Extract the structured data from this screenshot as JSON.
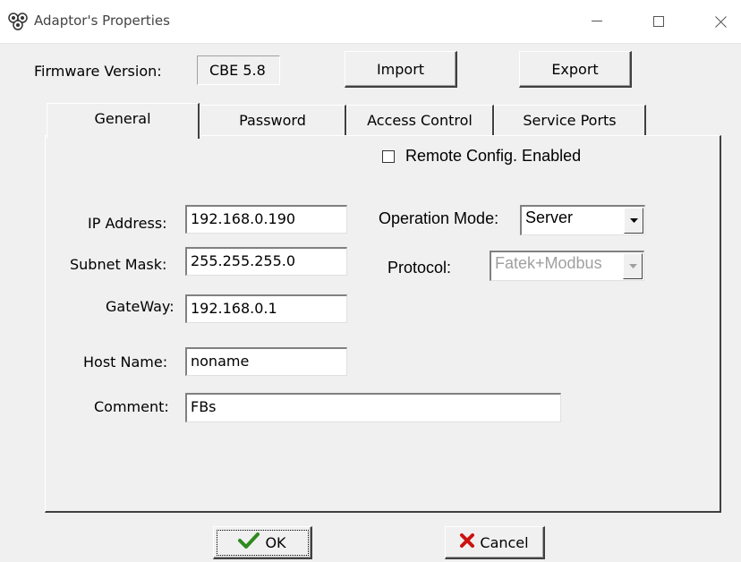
{
  "window": {
    "title": "Adaptor's Properties",
    "icon": "adaptor-app-icon",
    "controls": [
      "minimize-icon",
      "maximize-icon",
      "close-icon"
    ]
  },
  "firmware": {
    "label": "Firmware Version:",
    "value": "CBE 5.8"
  },
  "buttons": {
    "import": "Import",
    "export": "Export",
    "ok": "OK",
    "cancel": "Cancel"
  },
  "tabs": [
    {
      "label": "General",
      "active": true
    },
    {
      "label": "Password",
      "active": false
    },
    {
      "label": "Access Control",
      "active": false
    },
    {
      "label": "Service Ports",
      "active": false
    }
  ],
  "general": {
    "remote_config": {
      "label": "Remote Config. Enabled",
      "checked": false
    },
    "ip_address": {
      "label": "IP Address:",
      "value": "192.168.0.190"
    },
    "subnet_mask": {
      "label": "Subnet Mask:",
      "value": "255.255.255.0"
    },
    "gateway": {
      "label": "GateWay:",
      "value": "192.168.0.1"
    },
    "host_name": {
      "label": "Host Name:",
      "value": "noname"
    },
    "comment": {
      "label": "Comment:",
      "value": "FBs"
    },
    "operation_mode": {
      "label": "Operation Mode:",
      "value": "Server"
    },
    "protocol": {
      "label": "Protocol:",
      "value": "Fatek+Modbus",
      "disabled": true
    }
  },
  "colors": {
    "face": "#f0f0f0",
    "ok_check": "#2e8b1e",
    "cancel_x": "#cc1111",
    "disabled_text": "#a0a0a0"
  }
}
